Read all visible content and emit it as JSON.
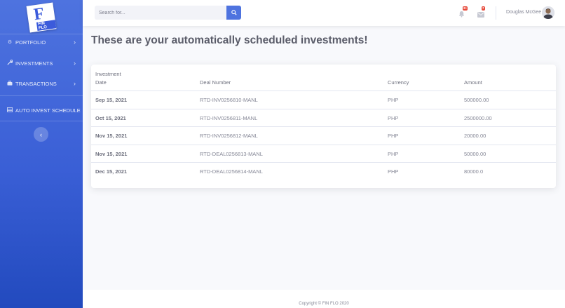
{
  "brand": {
    "logo_letter": "F",
    "logo_text": "FIN FLO"
  },
  "sidebar": {
    "items": [
      {
        "label": "PORTFOLIO",
        "icon": "gear-icon"
      },
      {
        "label": "INVESTMENTS",
        "icon": "wrench-icon"
      },
      {
        "label": "TRANSACTIONS",
        "icon": "briefcase-icon"
      },
      {
        "label": "AUTO INVEST SCHEDULE",
        "icon": "table-icon"
      }
    ],
    "toggle_icon": "chevron-left-icon"
  },
  "search": {
    "placeholder": "Search for..."
  },
  "alerts": {
    "count": "3+",
    "icon": "bell-icon"
  },
  "messages": {
    "count": "7",
    "icon": "envelope-icon"
  },
  "user": {
    "name": "Douglas McGee"
  },
  "page": {
    "title": "These are your automatically scheduled investments!"
  },
  "table": {
    "headers": {
      "date_line1": "Investment",
      "date_line2": "Date",
      "deal": "Deal Number",
      "currency": "Currency",
      "amount": "Amount"
    },
    "rows": [
      {
        "date": "Sep 15, 2021",
        "deal": "RTD-INV0256810-MANL",
        "currency": "PHP",
        "amount": "500000.00"
      },
      {
        "date": "Oct 15, 2021",
        "deal": "RTD-INV0256811-MANL",
        "currency": "PHP",
        "amount": "2500000.00"
      },
      {
        "date": "Nov 15, 2021",
        "deal": "RTD-INV0256812-MANL",
        "currency": "PHP",
        "amount": "20000.00"
      },
      {
        "date": "Nov 15, 2021",
        "deal": "RTD-DEAL0256813-MANL",
        "currency": "PHP",
        "amount": "50000.00"
      },
      {
        "date": "Dec 15, 2021",
        "deal": "RTD-DEAL0256814-MANL",
        "currency": "PHP",
        "amount": "80000.0"
      }
    ]
  },
  "footer": {
    "copyright": "Copyright © FIN FLO 2020"
  },
  "colors": {
    "primary": "#4e73df",
    "sidebar_dark": "#224abe",
    "badge": "#e74a3b"
  }
}
